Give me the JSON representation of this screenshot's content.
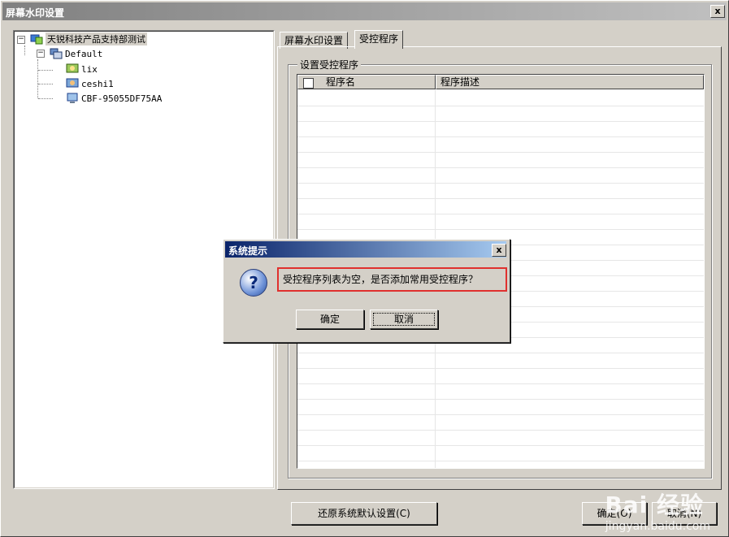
{
  "window": {
    "title": "屏幕水印设置",
    "close_label": "x"
  },
  "tree": {
    "root": "天锐科技产品支持部测试",
    "group": "Default",
    "children": [
      "lix",
      "ceshi1",
      "CBF-95055DF75AA"
    ],
    "expander_minus": "−"
  },
  "tabs": [
    {
      "label": "屏幕水印设置"
    },
    {
      "label": "受控程序"
    }
  ],
  "group": {
    "title": "设置受控程序"
  },
  "list": {
    "columns": [
      "程序名",
      "程序描述"
    ]
  },
  "footer": {
    "restore_label": "还原系统默认设置(C)",
    "ok_label": "确定(O)",
    "cancel_label": "取消(N)"
  },
  "dialog": {
    "title": "系统提示",
    "close_label": "x",
    "icon": "question-icon",
    "icon_glyph": "?",
    "message": "受控程序列表为空，是否添加常用受控程序？",
    "ok_label": "确定",
    "cancel_label": "取消"
  },
  "watermark": {
    "brand": "Bai 经验",
    "url": "jingyan.baidu.com"
  }
}
